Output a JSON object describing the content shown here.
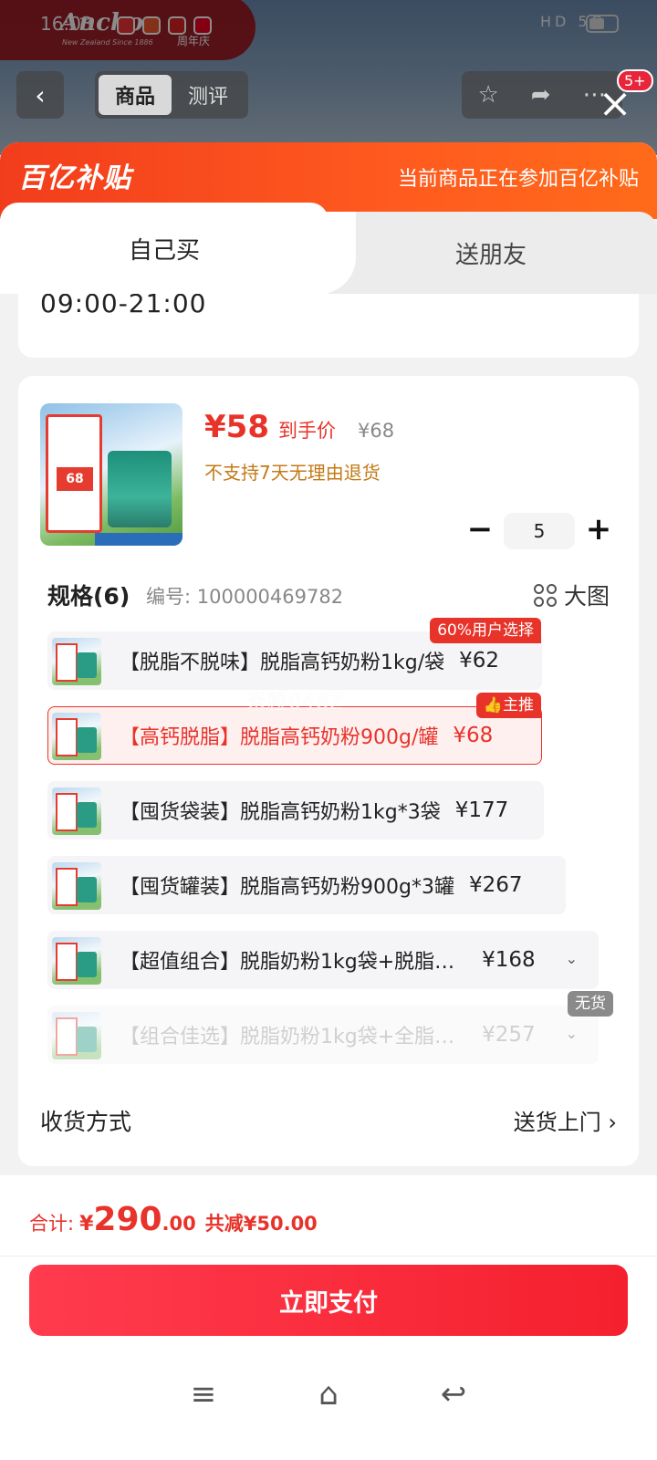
{
  "status_bar": {
    "time": "16:03",
    "anniversary": "周年庆",
    "icons": "HD 5G"
  },
  "background": {
    "brand": "Anchor",
    "brand_sub": "New Zealand Since 1886",
    "nav": {
      "tabs": [
        "商品",
        "测评"
      ],
      "active_tab": 0,
      "badge": "5+"
    }
  },
  "banner": {
    "logo": "百亿补贴",
    "message": "当前商品正在参加百亿补贴"
  },
  "tabs": {
    "self": "自己买",
    "friend": "送朋友"
  },
  "time_card": {
    "hours": "09:00-21:00"
  },
  "product": {
    "thumb_price": "68",
    "price_now": "¥58",
    "price_label": "到手价",
    "price_original": "¥68",
    "no_return": "不支持7天无理由退货",
    "quantity": "5"
  },
  "spec": {
    "title": "规格(6)",
    "code": "编号: 100000469782",
    "view_large": "大图"
  },
  "options": [
    {
      "name": "【脱脂不脱味】脱脂高钙奶粉1kg/袋",
      "price": "¥62",
      "tag": "60%用户选择"
    },
    {
      "name": "【高钙脱脂】脱脂高钙奶粉900g/罐",
      "price": "¥68",
      "tag": "主推"
    },
    {
      "name": "【囤货袋装】脱脂高钙奶粉1kg*3袋",
      "price": "¥177"
    },
    {
      "name": "【囤货罐装】脱脂高钙奶粉900g*3罐",
      "price": "¥267"
    },
    {
      "name": "【超值组合】脱脂奶粉1kg袋+脱脂…",
      "price": "¥168"
    },
    {
      "name": "【组合佳选】脱脂奶粉1kg袋+全脂…",
      "price": "¥257",
      "tag": "无货"
    }
  ],
  "watermark": "米粒048Z",
  "delivery": {
    "label": "收货方式",
    "value": "送货上门"
  },
  "footer": {
    "total_label": "合计:",
    "total_yen": "¥",
    "total_int": "290",
    "total_dec": ".00",
    "save": "共减¥50.00",
    "pay": "立即支付"
  },
  "colors": {
    "accent": "#e8332a",
    "banner": "#f23d1c",
    "pay_button": "#f5202e",
    "warning_text": "#c37a17"
  }
}
